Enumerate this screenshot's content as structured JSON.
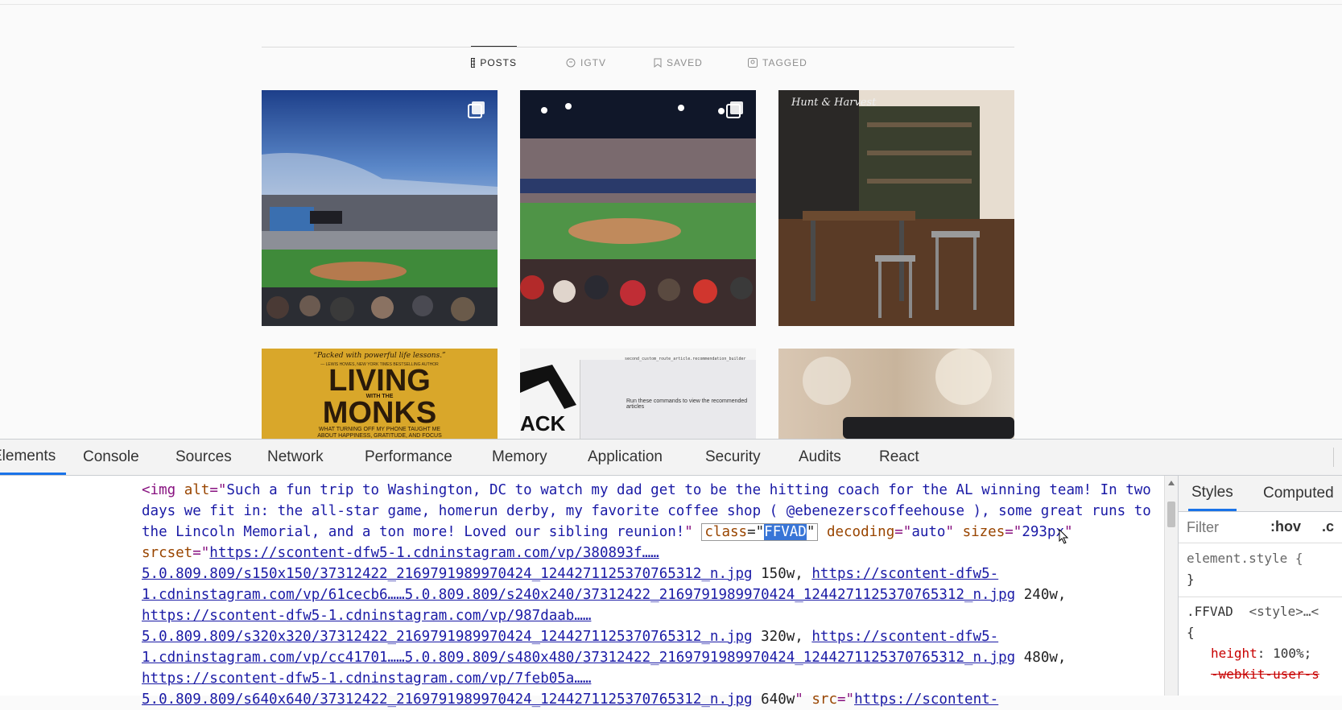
{
  "profile": {
    "tabs": [
      {
        "label": "POSTS",
        "icon": "grid-icon",
        "active": true
      },
      {
        "label": "IGTV",
        "icon": "igtv-icon",
        "active": false
      },
      {
        "label": "SAVED",
        "icon": "bookmark-icon",
        "active": false
      },
      {
        "label": "TAGGED",
        "icon": "tag-person-icon",
        "active": false
      }
    ],
    "book_tile": {
      "quote": "“Packed with powerful life lessons.”",
      "quote_author": "— LEWIS HOWES, NEW YORK TIMES BESTSELLING AUTHOR",
      "title_line1": "LIVING",
      "title_small": "WITH THE",
      "title_line2": "MONKS",
      "subtitle_line1": "WHAT TURNING OFF MY PHONE TAUGHT ME",
      "subtitle_line2": "ABOUT HAPPINESS, GRATITUDE, AND FOCUS"
    },
    "code_tile": {
      "logo": "ACK",
      "line1": "second_custom_route_article.recommendation_builder",
      "line2": "Run these commands to view the recommended articles"
    },
    "cafe_tile": {
      "sign": "Hunt & Harvest"
    }
  },
  "devtools": {
    "tabs": [
      "Elements",
      "Console",
      "Sources",
      "Network",
      "Performance",
      "Memory",
      "Application",
      "Security",
      "Audits",
      "React"
    ],
    "active_tab": "Elements",
    "element": {
      "tag": "img",
      "alt_attr": "alt",
      "alt_value": "Such a fun trip to Washington, DC to watch my dad get to be the hitting coach for the AL winning team! In two days we fit in: the all-star game, homerun derby, my favorite coffee shop ( @ebenezerscoffeehouse ), some great runs to the Lincoln Memorial, and a ton more! Loved our sibling reunion!",
      "class_attr": "class",
      "class_value": "FFVAD",
      "decoding_attr": "decoding",
      "decoding_value": "auto",
      "sizes_attr": "sizes",
      "sizes_value": "293px",
      "srcset_attr": "srcset",
      "srcset_url1a": "https://scontent-dfw5-1.cdninstagram.com/vp/380893f……5.0.809.809/",
      "srcset_url1b": "s150x150/37312422_2169791989970424_1244271125370765312_n.jpg",
      "srcset_w1": "150w,",
      "srcset_url2a": "https://scontent-dfw5-1.cdninstagram.com/",
      "srcset_url2b": "vp/61cecb6……5.0.809.809/s240x240/37312422_2169791989970424_1244271125370765312_n.jpg",
      "srcset_w2": "240w,",
      "srcset_url3a": "https://scontent-",
      "srcset_url3b": "dfw5-1.cdninstagram.com/vp/987daab……5.0.809.809/s320x320/37312422_2169791989970424_1244271125370765312_n.jpg",
      "srcset_w3": "320w,",
      "srcset_url4a": "https://scontent-dfw5-1.cdninstagram.com/vp/cc41701……5.0.809.809/s480x480/",
      "srcset_url4b": "37312422_2169791989970424_1244271125370765312_n.jpg",
      "srcset_w4": "480w,",
      "srcset_url5a": "https://scontent-dfw5-1.cdninstagram.com/vp/",
      "srcset_url5b": "7feb05a……5.0.809.809/s640x640/37312422_2169791989970424_1244271125370765312_n.jpg",
      "srcset_w5": "640w",
      "src_attr": "src",
      "src_url": "https://scontent-"
    },
    "styles": {
      "tabs": [
        "Styles",
        "Computed"
      ],
      "filter_placeholder": "Filter",
      "hov": ":hov",
      "cls": ".c",
      "element_style": "element.style {",
      "close_brace": "}",
      "rule_selector": ".FFVAD",
      "rule_source": "<style>…<",
      "open_brace": "{",
      "prop1_name": "height",
      "prop1_value": "100%;",
      "prop2": "-webkit-user-s"
    }
  },
  "colors": {
    "accent": "#1a73e8",
    "tag": "#881280",
    "attr": "#994500",
    "value": "#1a1aa6"
  }
}
